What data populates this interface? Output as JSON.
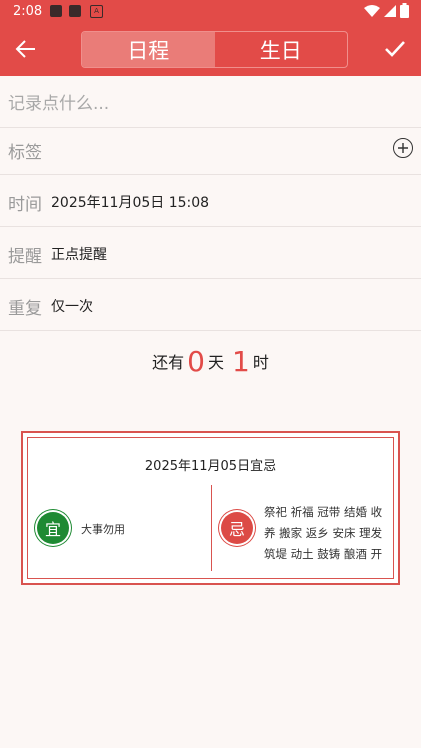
{
  "status_bar": {
    "time": "2:08"
  },
  "top_bar": {
    "tabs": [
      {
        "label": "日程",
        "active": true
      },
      {
        "label": "生日",
        "active": false
      }
    ]
  },
  "form": {
    "note_placeholder": "记录点什么...",
    "tag_label": "标签",
    "time_label": "时间",
    "time_value": "2025年11月05日 15:08",
    "remind_label": "提醒",
    "remind_value": "正点提醒",
    "repeat_label": "重复",
    "repeat_value": "仅一次"
  },
  "countdown": {
    "prefix": "还有",
    "days": "0",
    "day_unit": "天",
    "hours": "1",
    "hour_unit": "时"
  },
  "almanac": {
    "title": "2025年11月05日宜忌",
    "yi_badge": "宜",
    "yi_text": "大事勿用",
    "ji_badge": "忌",
    "ji_text": "祭祀 祈福 冠带 结婚 收养 搬家 返乡 安床 理发 筑堤 动土 鼓铸 酿酒 开"
  },
  "colors": {
    "primary": "#e24b48",
    "yi": "#1e8a33",
    "ji": "#dc4a45"
  }
}
